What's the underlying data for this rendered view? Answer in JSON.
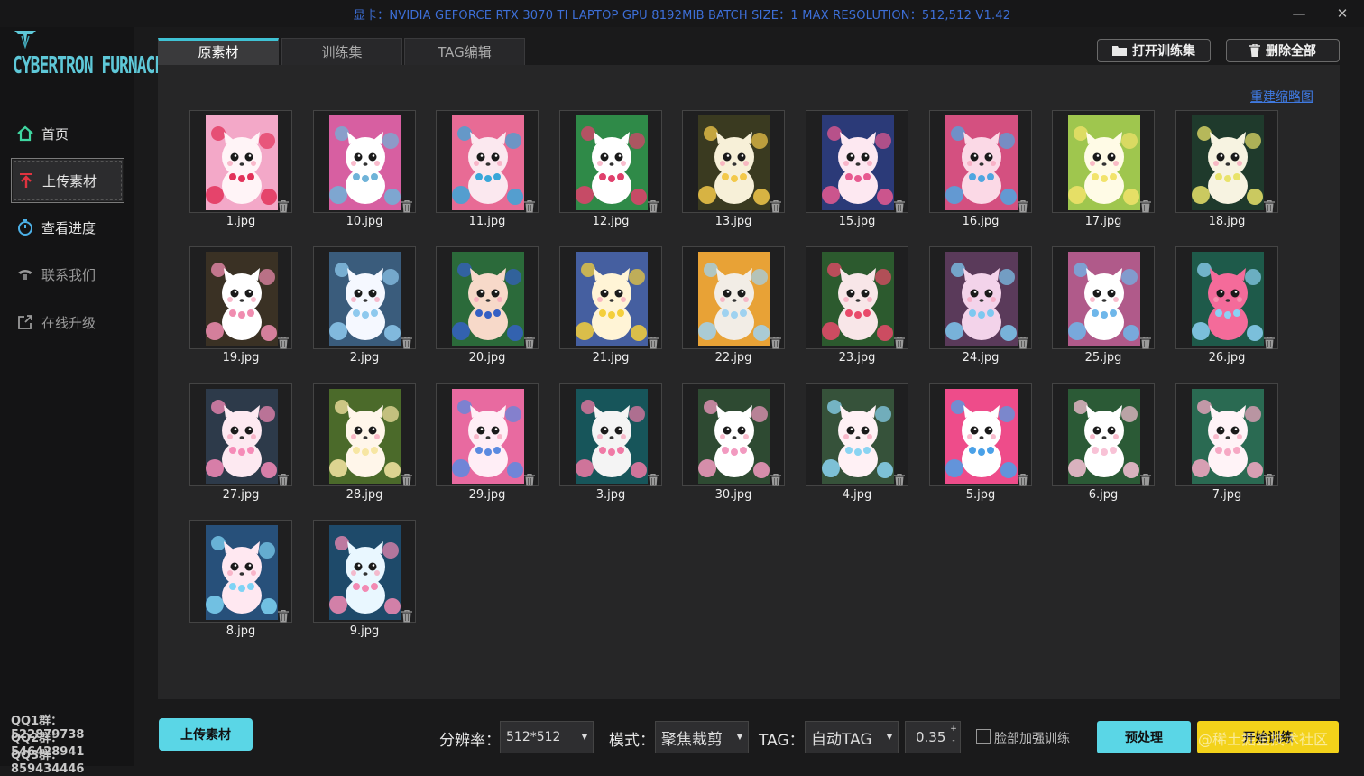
{
  "window": {
    "title": "显卡：NVIDIA GEFORCE RTX 3070 TI LAPTOP GPU 8192MIB  BATCH SIZE：1  MAX RESOLUTION：512,512 V1.42",
    "minimize_glyph": "—",
    "close_glyph": "✕"
  },
  "brand": {
    "logo_text": "CYBERTRON FURNACE",
    "accent": "#3fc2d4"
  },
  "sidebar": {
    "items": [
      {
        "label": "首页",
        "icon": "home-icon"
      },
      {
        "label": "上传素材",
        "icon": "upload-icon"
      },
      {
        "label": "查看进度",
        "icon": "stopwatch-icon"
      },
      {
        "label": "联系我们",
        "icon": "phone-icon"
      },
      {
        "label": "在线升级",
        "icon": "external-link-icon"
      }
    ],
    "qq": [
      "QQ1群：522879738",
      "QQ2群：546428941",
      "QQ3群：859434446"
    ]
  },
  "tabs": [
    {
      "label": "原素材",
      "active": true
    },
    {
      "label": "训练集",
      "active": false
    },
    {
      "label": "TAG编辑",
      "active": false
    }
  ],
  "toolbar": {
    "open_train_label": "打开训练集",
    "delete_all_label": "删除全部",
    "rebuild_thumbs_label": "重建缩略图"
  },
  "images": [
    {
      "name": "1.jpg",
      "palette": [
        "#f3a8c8",
        "#e2325a",
        "#fff4f7"
      ]
    },
    {
      "name": "10.jpg",
      "palette": [
        "#d75fa1",
        "#6fb3d8",
        "#fff"
      ]
    },
    {
      "name": "11.jpg",
      "palette": [
        "#e86b95",
        "#39a7d9",
        "#fbe8ef"
      ]
    },
    {
      "name": "12.jpg",
      "palette": [
        "#2f8a48",
        "#e0406c",
        "#ffffff"
      ]
    },
    {
      "name": "13.jpg",
      "palette": [
        "#3a3a20",
        "#f3c94a",
        "#f7f0d8"
      ]
    },
    {
      "name": "15.jpg",
      "palette": [
        "#2b3a78",
        "#e75a90",
        "#fde8f1"
      ]
    },
    {
      "name": "16.jpg",
      "palette": [
        "#d45080",
        "#4fa6e0",
        "#fbd9e6"
      ]
    },
    {
      "name": "17.jpg",
      "palette": [
        "#9fc64e",
        "#f2e36b",
        "#fffbe6"
      ]
    },
    {
      "name": "18.jpg",
      "palette": [
        "#1f3a2c",
        "#e9e36a",
        "#f7f3e1"
      ]
    },
    {
      "name": "19.jpg",
      "palette": [
        "#3a3124",
        "#f08db0",
        "#fff"
      ]
    },
    {
      "name": "2.jpg",
      "palette": [
        "#3a5c7c",
        "#8ec9ee",
        "#f5f8ff"
      ]
    },
    {
      "name": "20.jpg",
      "palette": [
        "#2b6a3a",
        "#3560c4",
        "#f7d9c9"
      ]
    },
    {
      "name": "21.jpg",
      "palette": [
        "#455fa0",
        "#f4cf3b",
        "#fff4d6"
      ]
    },
    {
      "name": "22.jpg",
      "palette": [
        "#e8a236",
        "#9fd2f0",
        "#f2ede6"
      ]
    },
    {
      "name": "23.jpg",
      "palette": [
        "#2c5a2e",
        "#e94a6a",
        "#f8e6e8"
      ]
    },
    {
      "name": "24.jpg",
      "palette": [
        "#5a3a5a",
        "#7ec8f0",
        "#f3d3ea"
      ]
    },
    {
      "name": "25.jpg",
      "palette": [
        "#b05a8a",
        "#6fb7ea",
        "#ffffff"
      ]
    },
    {
      "name": "26.jpg",
      "palette": [
        "#1e5a4a",
        "#8cd1f4",
        "#f46b9a"
      ]
    },
    {
      "name": "27.jpg",
      "palette": [
        "#2d3a4a",
        "#f68bb8",
        "#fde9f1"
      ]
    },
    {
      "name": "28.jpg",
      "palette": [
        "#4b6a2a",
        "#f7e6a3",
        "#fff6ea"
      ]
    },
    {
      "name": "29.jpg",
      "palette": [
        "#e86aa0",
        "#5a8ae0",
        "#ffeef6"
      ]
    },
    {
      "name": "3.jpg",
      "palette": [
        "#17555a",
        "#f07aa6",
        "#f4f4f4"
      ]
    },
    {
      "name": "30.jpg",
      "palette": [
        "#2e4a32",
        "#f29ac0",
        "#fff"
      ]
    },
    {
      "name": "4.jpg",
      "palette": [
        "#36523a",
        "#8ad4f2",
        "#fff1f5"
      ]
    },
    {
      "name": "5.jpg",
      "palette": [
        "#ee4c8a",
        "#4aa1e8",
        "#ffffff"
      ]
    },
    {
      "name": "6.jpg",
      "palette": [
        "#2b5a36",
        "#f8c2d6",
        "#ffffff"
      ]
    },
    {
      "name": "7.jpg",
      "palette": [
        "#2a6a52",
        "#f6a8c4",
        "#fff3f7"
      ]
    },
    {
      "name": "8.jpg",
      "palette": [
        "#27507a",
        "#7fd3f5",
        "#ffe8f1"
      ]
    },
    {
      "name": "9.jpg",
      "palette": [
        "#1e4a6a",
        "#f289b3",
        "#e9f7ff"
      ]
    }
  ],
  "bottom": {
    "upload_label": "上传素材",
    "resolution_label": "分辨率：",
    "resolution_value": "512*512",
    "mode_label": "模式：",
    "mode_value": "聚焦裁剪",
    "tag_label": "TAG：",
    "tag_value": "自动TAG",
    "threshold_value": "0.35",
    "face_enhance_label": "脸部加强训练",
    "face_enhance_checked": false,
    "preprocess_label": "预处理",
    "start_train_label": "开始训练",
    "watermark": "@稀土掘金技术社区"
  }
}
